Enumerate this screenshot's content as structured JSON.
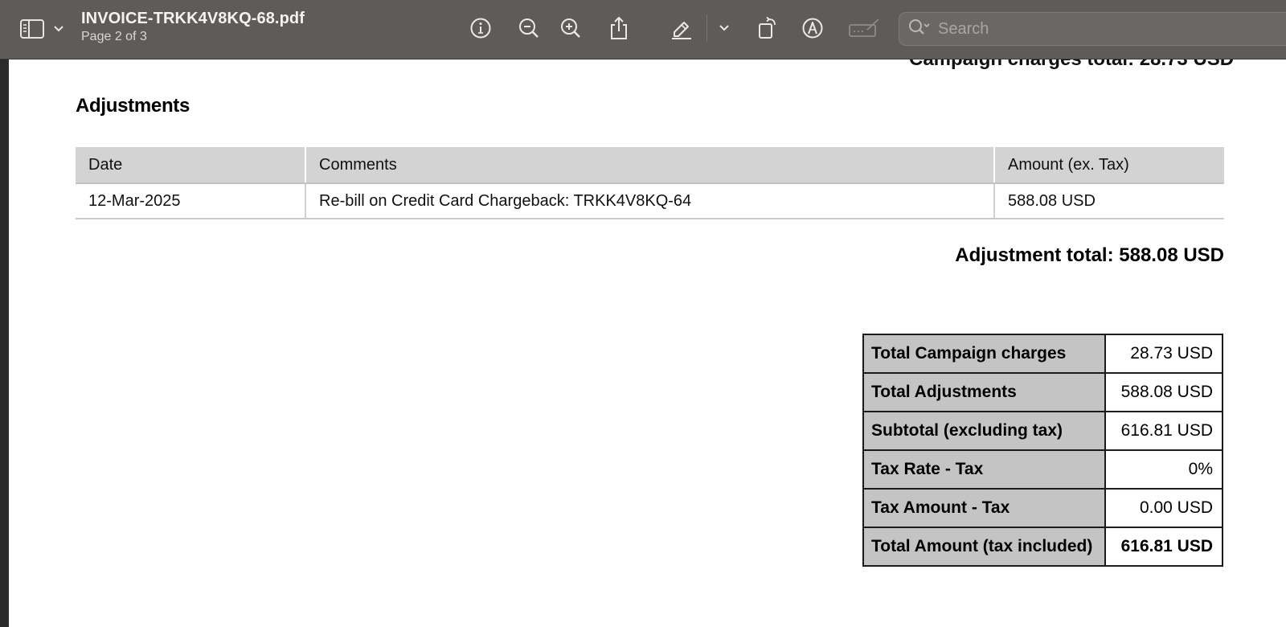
{
  "toolbar": {
    "file_name": "INVOICE-TRKK4V8KQ-68.pdf",
    "page_indicator": "Page 2 of 3",
    "search_placeholder": "Search",
    "icons": [
      "sidebar-icon",
      "chevron-down-icon",
      "info-icon",
      "zoom-out-icon",
      "zoom-in-icon",
      "share-icon",
      "highlight-pen-icon",
      "chevron-down-icon",
      "rotate-icon",
      "markup-icon",
      "signature-icon",
      "search-icon"
    ]
  },
  "document": {
    "partial_heading": "Campaign charges total: 28.73 USD",
    "section_title": "Adjustments",
    "adjustments_table": {
      "headers": [
        "Date",
        "Comments",
        "Amount (ex. Tax)"
      ],
      "rows": [
        [
          "12-Mar-2025",
          "Re-bill on Credit Card Chargeback: TRKK4V8KQ-64",
          "588.08 USD"
        ]
      ]
    },
    "adjustment_total": "Adjustment total: 588.08 USD",
    "summary": [
      {
        "label": "Total Campaign charges",
        "value": "28.73 USD"
      },
      {
        "label": "Total Adjustments",
        "value": "588.08 USD"
      },
      {
        "label": "Subtotal (excluding tax)",
        "value": "616.81 USD"
      },
      {
        "label": "Tax Rate - Tax",
        "value": "0%"
      },
      {
        "label": "Tax Amount - Tax",
        "value": "0.00 USD"
      },
      {
        "label": "Total Amount (tax included)",
        "value": "616.81 USD"
      }
    ]
  },
  "colors": {
    "toolbar_bg": "#5f5b59",
    "header_cell_bg": "#d3d3d3",
    "summary_label_bg": "#c4c4c4"
  }
}
